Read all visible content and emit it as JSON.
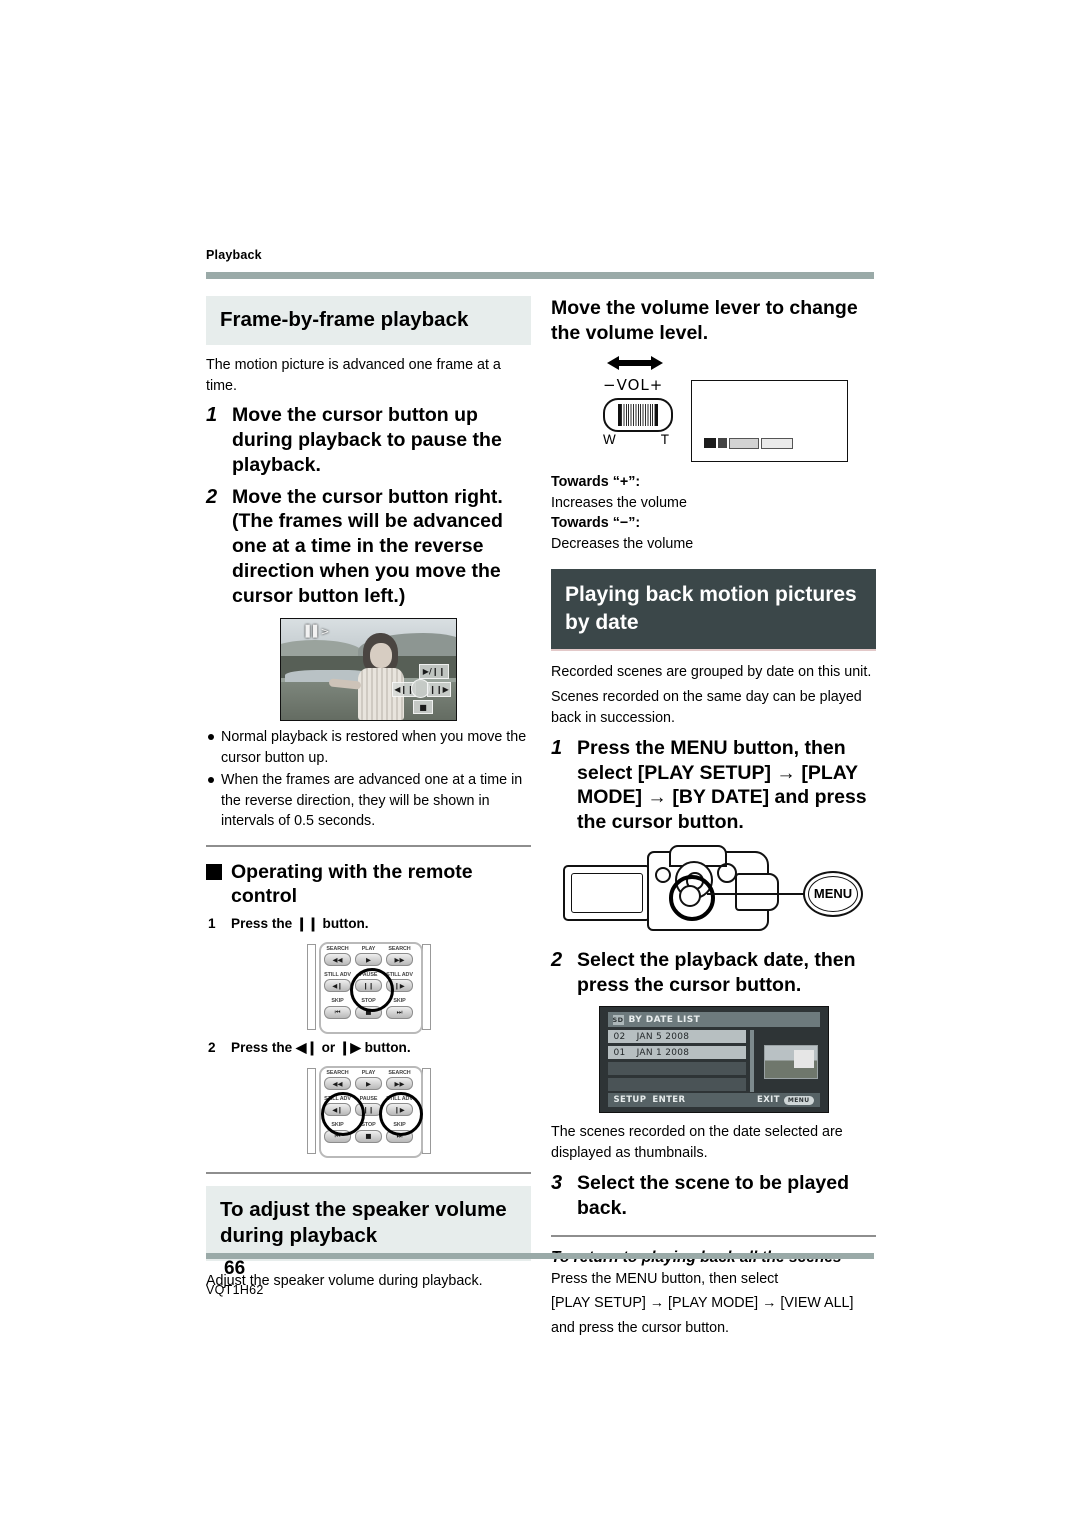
{
  "page": {
    "running_head": "Playback",
    "page_number": "66",
    "doc_code": "VQT1H62"
  },
  "left_column": {
    "heading": "Frame-by-frame playback",
    "intro": "The motion picture is advanced one frame at a time.",
    "steps": [
      {
        "num": "1",
        "text": "Move the cursor button up during playback to pause the playback."
      },
      {
        "num": "2",
        "text": "Move the cursor button right. (The frames will be advanced one at a time in the reverse direction when you move the cursor button left.)"
      }
    ],
    "photo_figure": {
      "osd_icon": "frame-advance-icon",
      "overlay_play_pause": "▶/❙❙",
      "overlay_frame_back": "◀❙❙",
      "overlay_frame_fwd": "❙❙▶",
      "overlay_stop": "■"
    },
    "bullets": [
      "Normal playback is restored when you move the cursor button up.",
      "When the frames are advanced one at a time in the reverse direction, they will be shown in intervals of 0.5 seconds."
    ],
    "remote_heading": "Operating with the remote control",
    "remote_steps": [
      {
        "num": "1",
        "text": "Press the ❙❙ button."
      },
      {
        "num": "2",
        "text": "Press the ◀❙ or ❙▶ button."
      }
    ],
    "remote_buttons": {
      "row1": [
        {
          "label": "SEARCH",
          "glyph": "◀◀"
        },
        {
          "label": "PLAY",
          "glyph": "▶"
        },
        {
          "label": "SEARCH",
          "glyph": "▶▶"
        }
      ],
      "row2": [
        {
          "label": "STILL ADV",
          "glyph": "◀❙"
        },
        {
          "label": "PAUSE",
          "glyph": "❙❙"
        },
        {
          "label": "STILL ADV",
          "glyph": "❙▶"
        }
      ],
      "row3": [
        {
          "label": "SKIP",
          "glyph": "⏮"
        },
        {
          "label": "STOP",
          "glyph": "■"
        },
        {
          "label": "SKIP",
          "glyph": "⏭"
        }
      ]
    },
    "speaker_heading": "To adjust the speaker volume during playback",
    "speaker_body": "Adjust the speaker volume during playback."
  },
  "right_column": {
    "volume_instruction": "Move the volume lever to change the volume level.",
    "volume_figure": {
      "lever_label": "−VOL+",
      "wide_mark": "W",
      "tele_mark": "T"
    },
    "volume_notes": [
      {
        "title": "Towards “+”:",
        "body": "Increases the volume"
      },
      {
        "title": "Towards “−”:",
        "body": "Decreases the volume"
      }
    ],
    "section_heading": "Playing back motion pictures by date",
    "section_intro_1": "Recorded scenes are grouped by date on this unit.",
    "section_intro_2": "Scenes recorded on the same day can be played back in succession.",
    "steps": [
      {
        "num": "1",
        "text": "Press the MENU button, then select [PLAY SETUP] → [PLAY MODE] → [BY DATE] and press the cursor button."
      },
      {
        "num": "2",
        "text": "Select the playback date, then press the cursor button."
      },
      {
        "num": "3",
        "text": "Select the scene to be played back."
      }
    ],
    "camcorder_figure": {
      "callout_label": "MENU"
    },
    "date_list_screen": {
      "title": "BY DATE LIST",
      "rows": [
        {
          "no": "02",
          "date": "JAN  5 2008"
        },
        {
          "no": "01",
          "date": "JAN  1 2008"
        }
      ],
      "footer_left": "SETUP",
      "footer_enter": "ENTER",
      "footer_exit": "EXIT",
      "footer_exit_chip": "MENU"
    },
    "thumbnails_note": "The scenes recorded on the date selected are displayed as thumbnails.",
    "return_note": {
      "title": "To return to playing back all the scenes",
      "body_1": "Press the MENU button, then select",
      "body_2": "[PLAY SETUP] → [PLAY MODE] → [VIEW ALL]",
      "body_3": "and press the cursor button."
    }
  },
  "colors": {
    "rule": "#9aaaa8",
    "subhead_bg": "#e7edec",
    "section_bg": "#3b4749",
    "screen_bg": "#2e3436"
  }
}
